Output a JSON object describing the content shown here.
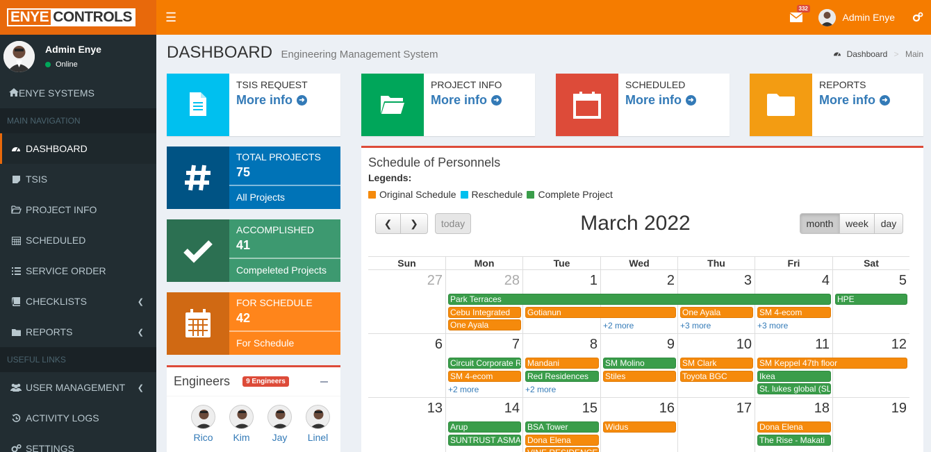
{
  "brand": {
    "logo_part1": "ENYE",
    "logo_part2": "CONTROLS"
  },
  "topbar": {
    "mail_count": "332",
    "user_name": "Admin Enye"
  },
  "sidebar": {
    "user_name": "Admin Enye",
    "status": "Online",
    "brand_item": "ENYE SYSTEMS",
    "header_main": "MAIN NAVIGATION",
    "header_useful": "USEFUL LINKS",
    "items": [
      {
        "label": "DASHBOARD",
        "icon": "dashboard-icon"
      },
      {
        "label": "TSIS",
        "icon": "sticky-note-icon"
      },
      {
        "label": "PROJECT INFO",
        "icon": "folder-open-icon"
      },
      {
        "label": "SCHEDULED",
        "icon": "calendar-icon"
      },
      {
        "label": "SERVICE ORDER",
        "icon": "list-icon"
      },
      {
        "label": "CHECKLISTS",
        "icon": "book-icon"
      },
      {
        "label": "REPORTS",
        "icon": "folder-icon"
      },
      {
        "label": "USER MANAGEMENT",
        "icon": "users-icon"
      },
      {
        "label": "ACTIVITY LOGS",
        "icon": "history-icon"
      },
      {
        "label": "SETTINGS",
        "icon": "gears-icon"
      }
    ]
  },
  "header": {
    "title": "DASHBOARD",
    "subtitle": "Engineering Management System",
    "breadcrumb_home": "Dashboard",
    "breadcrumb_current": "Main"
  },
  "info_boxes": [
    {
      "title": "TSIS REQUEST",
      "link": "More info",
      "color": "#00c0ef",
      "icon": "document-icon"
    },
    {
      "title": "PROJECT INFO",
      "link": "More info",
      "color": "#00a65a",
      "icon": "folder-open-icon"
    },
    {
      "title": "SCHEDULED",
      "link": "More info",
      "color": "#dd4b39",
      "icon": "calendar-icon"
    },
    {
      "title": "REPORTS",
      "link": "More info",
      "color": "#f39c12",
      "icon": "folder-icon"
    }
  ],
  "stats": [
    {
      "title": "TOTAL PROJECTS",
      "value": "75",
      "footer": "All Projects",
      "color": "#0073b7",
      "icon_bg": "#005384"
    },
    {
      "title": "ACCOMPLISHED",
      "value": "41",
      "footer": "Compeleted Projects",
      "color": "#3d9970",
      "icon_bg": "#2c7052"
    },
    {
      "title": "FOR SCHEDULE",
      "value": "42",
      "footer": "For Schedule",
      "color": "#ff851b",
      "icon_bg": "#d06913"
    }
  ],
  "engineers": {
    "title": "Engineers",
    "badge": "9 Engineers",
    "list": [
      "Rico",
      "Kim",
      "Jay",
      "Linel"
    ]
  },
  "calendar": {
    "box_title": "Schedule of Personnels",
    "legends_label": "Legends:",
    "legend": [
      {
        "label": "Original Schedule",
        "color": "#f58a0c"
      },
      {
        "label": "Reschedule",
        "color": "#00c0ef"
      },
      {
        "label": "Complete Project",
        "color": "#3a9d4a"
      }
    ],
    "today_label": "today",
    "month_label": "March 2022",
    "views": [
      "month",
      "week",
      "day"
    ],
    "weekdays": [
      "Sun",
      "Mon",
      "Tue",
      "Wed",
      "Thu",
      "Fri",
      "Sat"
    ],
    "weeks": [
      {
        "days": [
          "27",
          "28",
          "1",
          "2",
          "3",
          "4",
          "5"
        ],
        "other": [
          true,
          true,
          false,
          false,
          false,
          false,
          false
        ],
        "events": [
          {
            "title": "Park Terraces",
            "color": "g",
            "start": 1,
            "span": 5,
            "row": 0
          },
          {
            "title": "HPE",
            "color": "g",
            "start": 6,
            "span": 1,
            "row": 0
          },
          {
            "title": "Cebu Integrated",
            "color": "o",
            "start": 1,
            "span": 1,
            "row": 1
          },
          {
            "title": "Gotianun",
            "color": "o",
            "start": 2,
            "span": 2,
            "row": 1
          },
          {
            "title": "One Ayala",
            "color": "o",
            "start": 4,
            "span": 1,
            "row": 1
          },
          {
            "title": "SM 4-ecom",
            "color": "o",
            "start": 5,
            "span": 1,
            "row": 1
          },
          {
            "title": "One Ayala",
            "color": "o",
            "start": 1,
            "span": 1,
            "row": 2
          }
        ],
        "more": [
          {
            "text": "+2 more",
            "col": 3
          },
          {
            "text": "+3 more",
            "col": 4
          },
          {
            "text": "+3 more",
            "col": 5
          }
        ]
      },
      {
        "days": [
          "6",
          "7",
          "8",
          "9",
          "10",
          "11",
          "12"
        ],
        "other": [
          false,
          false,
          false,
          false,
          false,
          false,
          false
        ],
        "events": [
          {
            "title": "Circuit Corporate R",
            "color": "g",
            "start": 1,
            "span": 1,
            "row": 0
          },
          {
            "title": "Mandani",
            "color": "o",
            "start": 2,
            "span": 1,
            "row": 0
          },
          {
            "title": "SM Molino",
            "color": "g",
            "start": 3,
            "span": 1,
            "row": 0
          },
          {
            "title": "SM Clark",
            "color": "o",
            "start": 4,
            "span": 1,
            "row": 0
          },
          {
            "title": "SM Keppel 47th floor",
            "color": "o",
            "start": 5,
            "span": 2,
            "row": 0
          },
          {
            "title": "SM 4-ecom",
            "color": "o",
            "start": 1,
            "span": 1,
            "row": 1
          },
          {
            "title": "Red Residences",
            "color": "g",
            "start": 2,
            "span": 1,
            "row": 1
          },
          {
            "title": "Stiles",
            "color": "o",
            "start": 3,
            "span": 1,
            "row": 1
          },
          {
            "title": "Toyota BGC",
            "color": "o",
            "start": 4,
            "span": 1,
            "row": 1
          },
          {
            "title": "Ikea",
            "color": "g",
            "start": 5,
            "span": 1,
            "row": 1
          },
          {
            "title": "St. lukes global (SL",
            "color": "g",
            "start": 5,
            "span": 1,
            "row": 2
          }
        ],
        "more": [
          {
            "text": "+2 more",
            "col": 1
          },
          {
            "text": "+2 more",
            "col": 2
          }
        ]
      },
      {
        "days": [
          "13",
          "14",
          "15",
          "16",
          "17",
          "18",
          "19"
        ],
        "other": [
          false,
          false,
          false,
          false,
          false,
          false,
          false
        ],
        "events": [
          {
            "title": "Arup",
            "color": "g",
            "start": 1,
            "span": 1,
            "row": 0
          },
          {
            "title": "BSA Tower",
            "color": "g",
            "start": 2,
            "span": 1,
            "row": 0
          },
          {
            "title": "Widus",
            "color": "o",
            "start": 3,
            "span": 1,
            "row": 0
          },
          {
            "title": "Dona Elena",
            "color": "o",
            "start": 5,
            "span": 1,
            "row": 0
          },
          {
            "title": "SUNTRUST ASMA",
            "color": "g",
            "start": 1,
            "span": 1,
            "row": 1
          },
          {
            "title": "Dona Elena",
            "color": "o",
            "start": 2,
            "span": 1,
            "row": 1
          },
          {
            "title": "The Rise - Makati",
            "color": "g",
            "start": 5,
            "span": 1,
            "row": 1
          },
          {
            "title": "VINE RESIDENCES",
            "color": "o",
            "start": 2,
            "span": 1,
            "row": 2
          }
        ],
        "more": []
      }
    ]
  }
}
